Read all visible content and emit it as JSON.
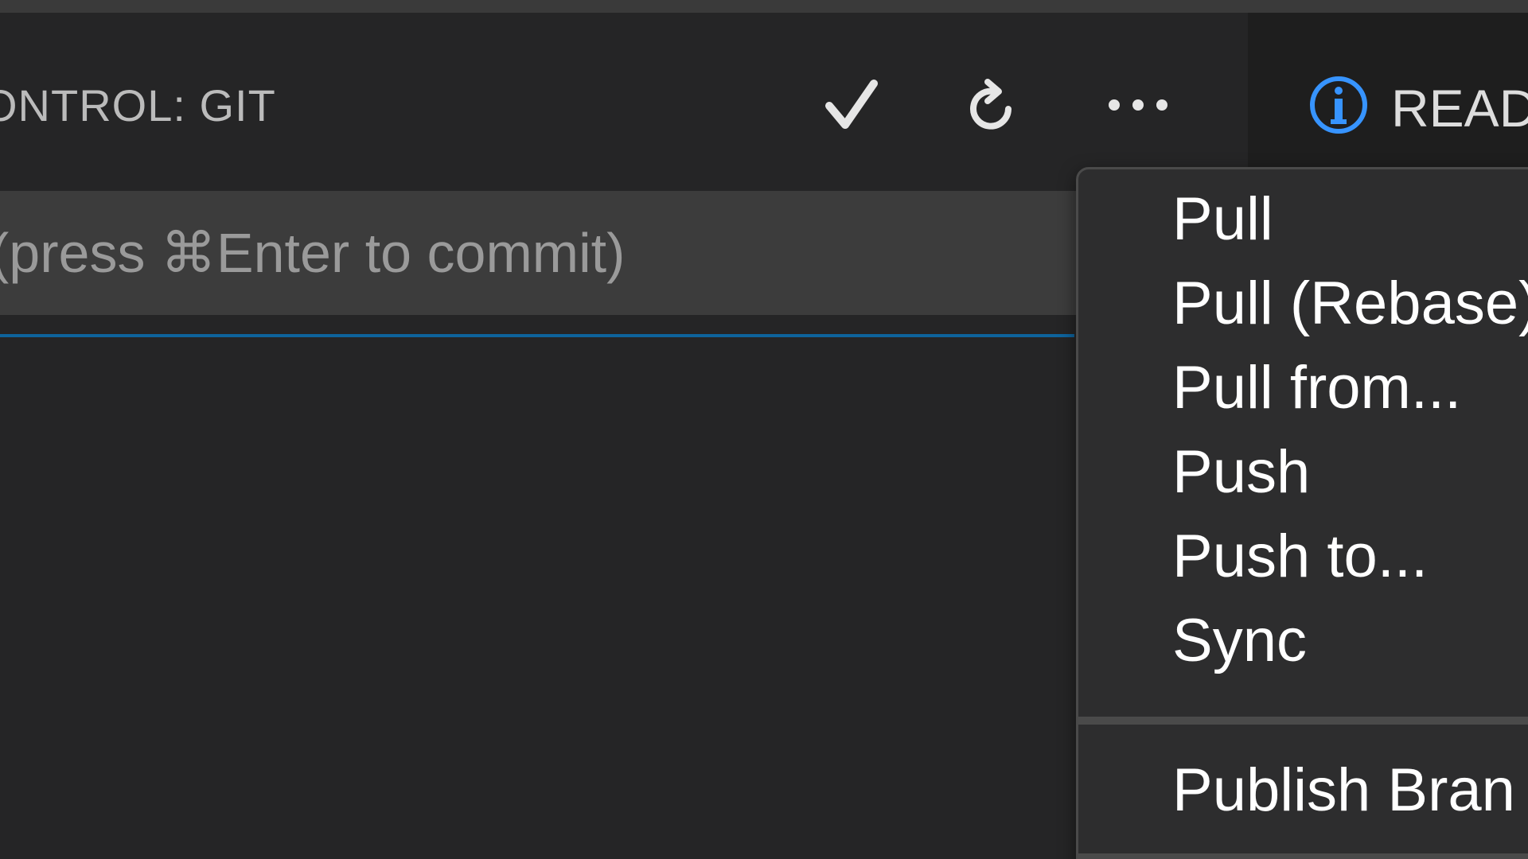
{
  "panel": {
    "title": "ONTROL: GIT"
  },
  "toolbar": {
    "commit_icon": "check-icon",
    "refresh_icon": "refresh-icon",
    "more_icon": "more-actions-icon"
  },
  "editor_tab": {
    "icon": "info-icon",
    "label": "READ"
  },
  "commit": {
    "placeholder": "(press ⌘Enter to commit)"
  },
  "menu": {
    "items": [
      {
        "label": "Pull"
      },
      {
        "label": "Pull (Rebase)"
      },
      {
        "label": "Pull from..."
      },
      {
        "label": "Push"
      },
      {
        "label": "Push to..."
      },
      {
        "label": "Sync"
      },
      {
        "label": "Publish Bran"
      }
    ]
  },
  "colors": {
    "background": "#252526",
    "input_background": "#3c3c3c",
    "focus_accent": "#0e639c",
    "info_icon": "#3794ff",
    "menu_background": "#2d2d2e"
  }
}
